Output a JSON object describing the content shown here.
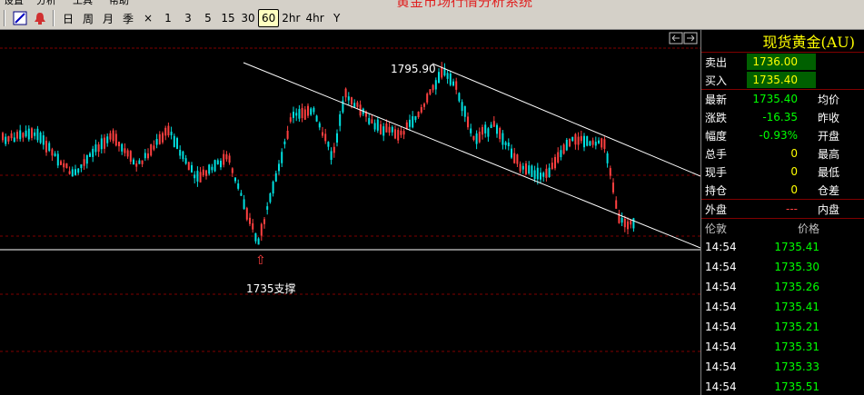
{
  "app": {
    "title": "黄金市场行情分析系统",
    "menu": [
      "设置",
      "分析",
      "工具",
      "帮助"
    ]
  },
  "toolbar": {
    "periods": [
      "日",
      "周",
      "月",
      "季",
      "×",
      "1",
      "3",
      "5",
      "15",
      "30",
      "60",
      "2hr",
      "4hr",
      "Y"
    ],
    "active_period": "60"
  },
  "chart": {
    "annotations": {
      "high_label": "1795.90",
      "support_label": "1735支撑",
      "arrow_glyph": "⇧"
    },
    "colors": {
      "up": "#ff4040",
      "down": "#00e0e0",
      "line": "#ffffff",
      "grid": "#800000"
    }
  },
  "panel": {
    "title": "现货黄金(AU)",
    "quotes": {
      "sell_label": "卖出",
      "sell_value": "1736.00",
      "buy_label": "买入",
      "buy_value": "1735.40",
      "last_label": "最新",
      "last_value": "1735.40",
      "avg_label": "均价",
      "change_label": "涨跌",
      "change_value": "-16.35",
      "prev_close_label": "昨收",
      "range_label": "幅度",
      "range_value": "-0.93%",
      "open_label": "开盘",
      "total_label": "总手",
      "total_value": "0",
      "high_label": "最高",
      "current_label": "现手",
      "current_value": "0",
      "low_label": "最低",
      "position_label": "持仓",
      "position_value": "0",
      "diff_label": "仓差",
      "outer_label": "外盘",
      "outer_value": "---",
      "inner_label": "内盘"
    },
    "ticks_header": {
      "time": "伦敦",
      "price": "价格"
    },
    "ticks": [
      {
        "time": "14:54",
        "price": "1735.41"
      },
      {
        "time": "14:54",
        "price": "1735.30"
      },
      {
        "time": "14:54",
        "price": "1735.26"
      },
      {
        "time": "14:54",
        "price": "1735.41"
      },
      {
        "time": "14:54",
        "price": "1735.21"
      },
      {
        "time": "14:54",
        "price": "1735.31"
      },
      {
        "time": "14:54",
        "price": "1735.33"
      },
      {
        "time": "14:54",
        "price": "1735.51"
      }
    ]
  }
}
